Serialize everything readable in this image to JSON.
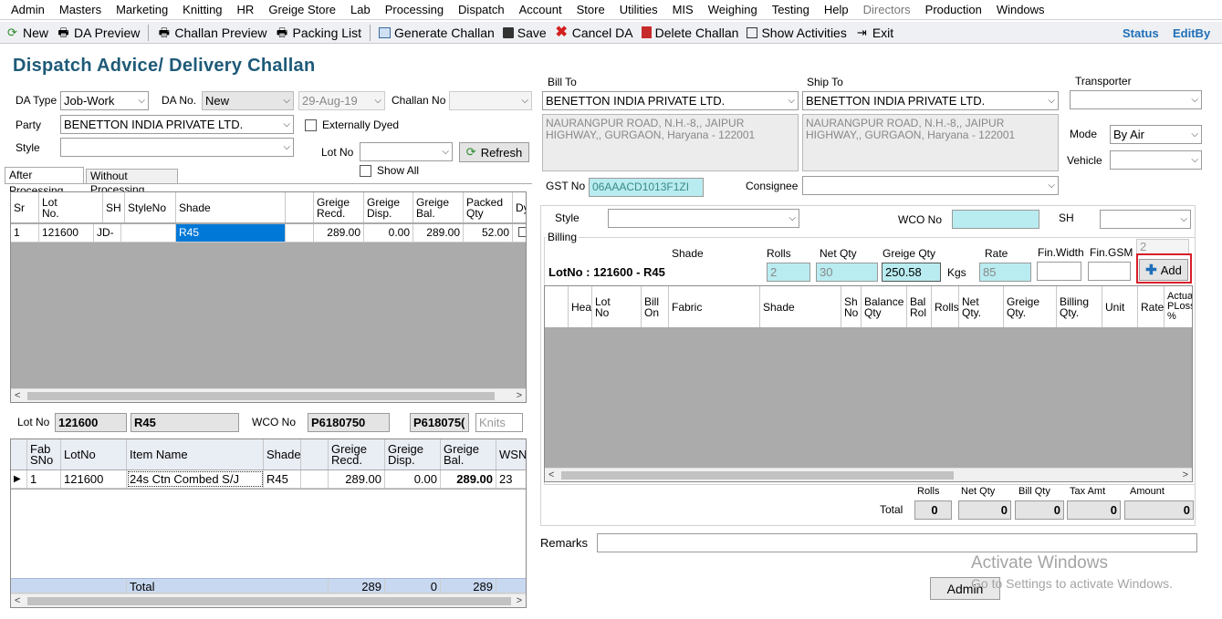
{
  "menu": [
    "Admin",
    "Masters",
    "Marketing",
    "Knitting",
    "HR",
    "Greige Store",
    "Lab",
    "Processing",
    "Dispatch",
    "Account",
    "Store",
    "Utilities",
    "MIS",
    "Weighing",
    "Testing",
    "Help",
    "Directors",
    "Production",
    "Windows"
  ],
  "toolbar": {
    "new": "New",
    "da_preview": "DA Preview",
    "challan_preview": "Challan Preview",
    "packing_list": "Packing List",
    "generate_challan": "Generate Challan",
    "save": "Save",
    "cancel_da": "Cancel DA",
    "delete_challan": "Delete Challan",
    "show_activities": "Show Activities",
    "exit": "Exit",
    "status": "Status",
    "editby": "EditBy"
  },
  "page_title": "Dispatch Advice/ Delivery Challan",
  "form": {
    "da_type_label": "DA Type",
    "da_type": "Job-Work",
    "da_no_label": "DA No.",
    "da_no": "New",
    "date": "29-Aug-19",
    "challan_no_label": "Challan No",
    "challan_no": "",
    "party_label": "Party",
    "party": "BENETTON INDIA PRIVATE LTD.",
    "ext_dyed_label": "Externally Dyed",
    "style_label": "Style",
    "style": "",
    "lot_no_label": "Lot No",
    "lot_no": "",
    "refresh_label": "Refresh",
    "show_all_label": "Show All"
  },
  "tabs": [
    "After Processing",
    "Without Processing"
  ],
  "lot_grid": {
    "headers": [
      "Sr",
      "Lot\nNo.",
      "SH",
      "StyleNo",
      "Shade",
      "",
      "Greige\nRecd.",
      "Greige\nDisp.",
      "Greige\nBal.",
      "Packed\nQty",
      "Dy"
    ],
    "rows": [
      [
        "1",
        "121600",
        "JD-",
        "",
        "R45",
        "",
        "289.00",
        "0.00",
        "289.00",
        "52.00",
        ""
      ]
    ]
  },
  "lot_info": {
    "lot_no_label": "Lot No",
    "lot_no": "121600",
    "shade": "R45",
    "wco_label": "WCO No",
    "wco_no": "P6180750",
    "wco_no2": "P618075(",
    "knits_placeholder": "Knits"
  },
  "item_grid": {
    "headers": [
      "Fab\nSNo",
      "LotNo",
      "Item Name",
      "Shade",
      "",
      "Greige\nRecd.",
      "Greige\nDisp.",
      "Greige\nBal.",
      "WSN"
    ],
    "rows": [
      [
        "1",
        "121600",
        "24s Ctn Combed S/J",
        "R45",
        "",
        "289.00",
        "0.00",
        "289.00",
        "23"
      ]
    ],
    "total_label": "Total",
    "totals": [
      "289",
      "0",
      "289"
    ]
  },
  "bill": {
    "bill_to_label": "Bill To",
    "bill_to": "BENETTON INDIA PRIVATE LTD.",
    "bill_address": "NAURANGPUR ROAD, N.H.-8,, JAIPUR HIGHWAY,, GURGAON, Haryana - 122001",
    "ship_to_label": "Ship To",
    "ship_to": "BENETTON INDIA PRIVATE LTD.",
    "ship_address": "NAURANGPUR ROAD, N.H.-8,, JAIPUR HIGHWAY,, GURGAON, Haryana - 122001",
    "transporter_label": "Transporter",
    "transporter": "",
    "mode_label": "Mode",
    "mode": "By Air",
    "vehicle_label": "Vehicle",
    "vehicle": "",
    "gst_label": "GST No",
    "gst_no": "06AAACD1013F1ZI",
    "consignee_label": "Consignee",
    "consignee": ""
  },
  "billing": {
    "style_label": "Style",
    "style": "",
    "wco_label": "WCO No",
    "wco": "",
    "sh_label": "SH",
    "sh": "",
    "group_label": "Billing",
    "lot_caption": "LotNo : 121600 - R45",
    "col_shade": "Shade",
    "col_rolls": "Rolls",
    "col_net_qty": "Net Qty",
    "col_greige_qty": "Greige Qty",
    "col_rate": "Rate",
    "col_fin_width": "Fin.Width",
    "col_fin_gsm": "Fin.GSM",
    "rolls": "2",
    "net_qty": "30",
    "greige_qty": "250.58",
    "kgs": "Kgs",
    "rate": "85",
    "fin_width": "",
    "fin_gsm": "",
    "top_small": "2",
    "add_label": "Add"
  },
  "billing_grid": {
    "headers": [
      "",
      "Hea",
      "Lot\nNo",
      "Bill\nOn",
      "Fabric",
      "Shade",
      "Sh\nNo",
      "Balance\nQty",
      "Bal\nRol",
      "Rolls",
      "Net\nQty.",
      "Greige\nQty.",
      "Billing\nQty.",
      "Unit",
      "Rate",
      "Actual\nPLoss\n%"
    ]
  },
  "totals": {
    "total_label": "Total",
    "rolls_label": "Rolls",
    "net_qty_label": "Net Qty",
    "bill_qty_label": "Bill Qty",
    "tax_amt_label": "Tax Amt",
    "amount_label": "Amount",
    "rolls": "0",
    "net_qty": "0",
    "bill_qty": "0",
    "tax_amt": "0",
    "amount": "0"
  },
  "remarks_label": "Remarks",
  "remarks": "",
  "user_button": "Admin",
  "watermark": {
    "line1": "Activate Windows",
    "line2": "Go to Settings to activate Windows."
  },
  "colors": {
    "title": "#1e5a78",
    "cyan_field": "#b9ecf0",
    "selection": "#0078d7",
    "highlight_border": "#d81e2a"
  }
}
